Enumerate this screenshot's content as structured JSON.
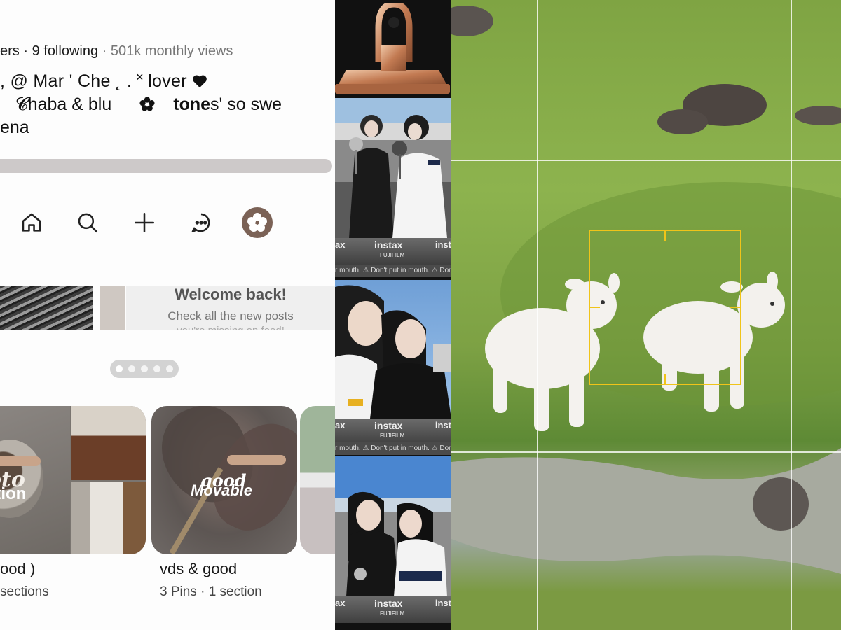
{
  "profile": {
    "followers_fragment": "ers",
    "following": "· 9 following",
    "views": "· 501k monthly views",
    "bio_line1": ", @ Mar ' Che ˛ . ˟ lover",
    "bio_line2_a": "𝓒haba & blu",
    "bio_line2_b": "tone",
    "bio_line2_c": "s' so swe",
    "bio_line3": "ena"
  },
  "nav": {
    "items": [
      "home-icon",
      "search-icon",
      "plus-icon",
      "message-icon",
      "avatar"
    ]
  },
  "welcome": {
    "title": "Welcome back!",
    "subtitle": "Check all the new posts",
    "subtitle2": "you're missing on feed!"
  },
  "pager": {
    "count": 5,
    "active": 0
  },
  "boards": [
    {
      "title": "ood )",
      "subtitle": "sections",
      "cover_text_1": "oto",
      "cover_text_2": "ation"
    },
    {
      "title": "vds & good",
      "subtitle": "3 Pins · 1 section",
      "cover_script": "good",
      "cover_title": "Movable"
    }
  ],
  "photo_strip": {
    "brand": "instax",
    "sub_brand": "FUJIFILM",
    "edge_left": "ax",
    "edge_right": "inst",
    "warning": "r mouth.   ⚠ Don't put in mouth.   ⚠ Don't pu"
  },
  "colors": {
    "accent_focus": "#f0c419",
    "progress": "#cdc9c9",
    "avatar": "#7b6256"
  }
}
